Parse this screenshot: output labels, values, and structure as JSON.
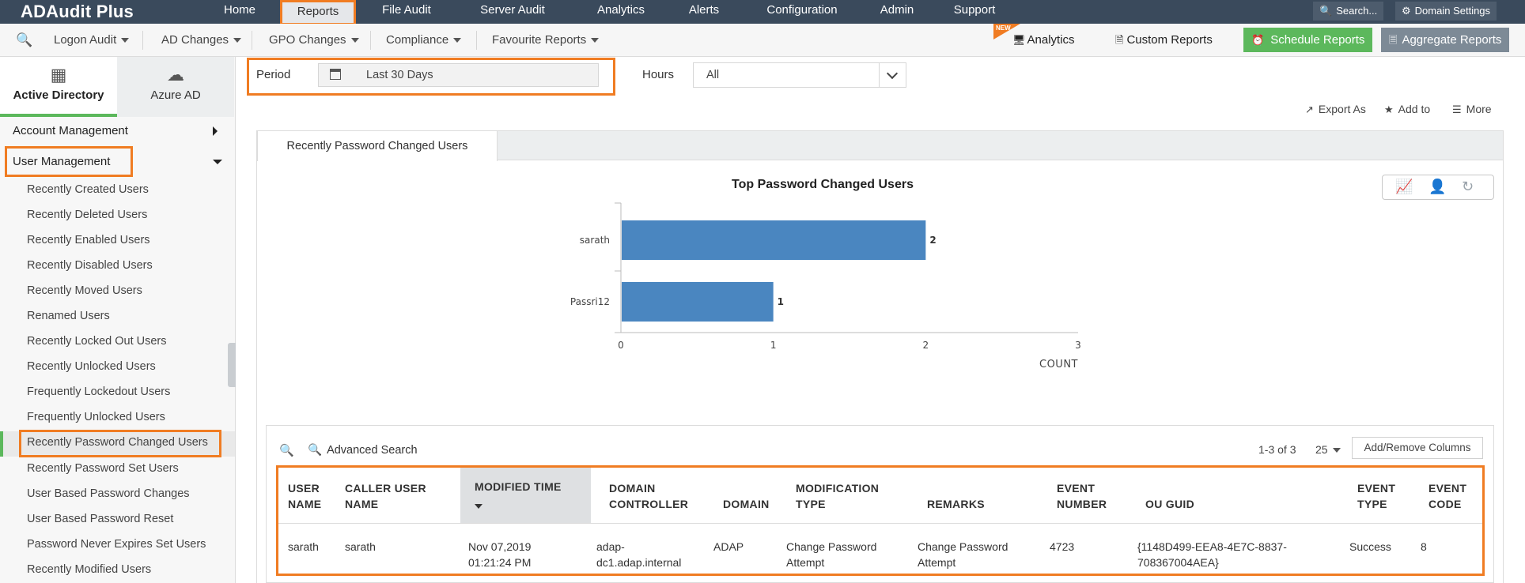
{
  "app": {
    "title": "ADAudit Plus"
  },
  "top_nav": {
    "items": [
      "Home",
      "Reports",
      "File Audit",
      "Server Audit",
      "Analytics",
      "Alerts",
      "Configuration",
      "Admin",
      "Support"
    ],
    "active": "Reports",
    "search_label": "Search...",
    "domain_settings_label": "Domain Settings"
  },
  "sub_nav": {
    "items": [
      "Logon Audit",
      "AD Changes",
      "GPO Changes",
      "Compliance",
      "Favourite Reports"
    ],
    "analytics_label": "Analytics",
    "new_badge": "NEW",
    "custom_reports_label": "Custom Reports",
    "schedule_reports_label": "Schedule Reports",
    "aggregate_reports_label": "Aggregate Reports"
  },
  "sidebar": {
    "tabs": [
      "Active Directory",
      "Azure AD"
    ],
    "sections": [
      "Account Management",
      "User Management"
    ],
    "items": [
      "Recently Created Users",
      "Recently Deleted Users",
      "Recently Enabled Users",
      "Recently Disabled Users",
      "Recently Moved Users",
      "Renamed Users",
      "Recently Locked Out Users",
      "Recently Unlocked Users",
      "Frequently Lockedout Users",
      "Frequently Unlocked Users",
      "Recently Password Changed Users",
      "Recently Password Set Users",
      "User Based Password Changes",
      "User Based Password Reset",
      "Password Never Expires Set Users",
      "Recently Modified Users"
    ],
    "selected_item": "Recently Password Changed Users"
  },
  "filters": {
    "period_label": "Period",
    "period_value": "Last 30 Days",
    "hours_label": "Hours",
    "hours_value": "All"
  },
  "actions": {
    "export_label": "Export As",
    "add_to_label": "Add to",
    "more_label": "More"
  },
  "report": {
    "tab_label": "Recently Password Changed Users"
  },
  "chart_data": {
    "type": "bar",
    "orientation": "horizontal",
    "title": "Top Password Changed Users",
    "categories": [
      "sarath",
      "Passri12"
    ],
    "values": [
      2,
      1
    ],
    "xlabel": "COUNT",
    "ylabel": "",
    "xlim": [
      0,
      3
    ],
    "xticks": [
      0,
      1,
      2,
      3
    ],
    "bar_color": "#4a86c0",
    "grid": false
  },
  "table": {
    "advanced_search_label": "Advanced Search",
    "pagination": "1-3 of 3",
    "page_size": "25",
    "add_remove_columns_label": "Add/Remove Columns",
    "columns": [
      "USER\nNAME",
      "CALLER USER\nNAME",
      "MODIFIED TIME",
      "DOMAIN\nCONTROLLER",
      "DOMAIN",
      "MODIFICATION\nTYPE",
      "REMARKS",
      "EVENT\nNUMBER",
      "OU GUID",
      "EVENT\nTYPE",
      "EVENT\nCODE"
    ],
    "sorted_column": "MODIFIED TIME",
    "rows": [
      [
        "sarath",
        "sarath",
        "Nov 07,2019\n01:21:24 PM",
        "adap-\ndc1.adap.internal",
        "ADAP",
        "Change Password\nAttempt",
        "Change Password\nAttempt",
        "4723",
        "{1148D499-EEA8-4E7C-8837-\n708367004AEA}",
        "Success",
        "8"
      ]
    ]
  },
  "colors": {
    "accent_highlight": "#f07c22",
    "active_green": "#5cb85c",
    "topbar": "#3a4a5c"
  }
}
